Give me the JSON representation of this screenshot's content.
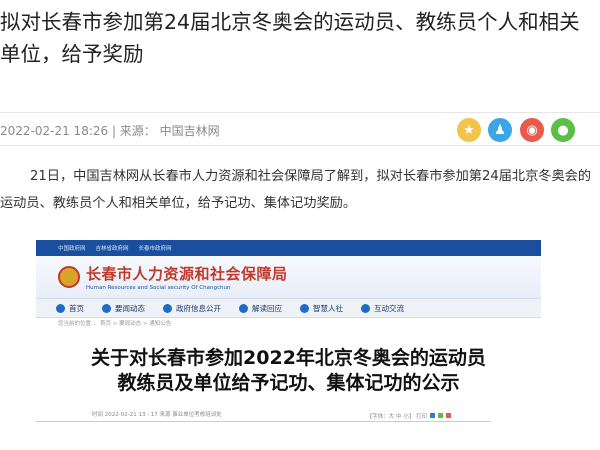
{
  "article": {
    "title": "拟对长春市参加第24届北京冬奥会的运动员、教练员个人和相关单位，给予奖励",
    "meta": "2022-02-21 18:26 | 来源： 中国吉林网",
    "paragraph": "21日，中国吉林网从长春市人力资源和社会保障局了解到，拟对长春市参加第24届北京冬奥会的运动员、教练员个人和相关单位，给予记功、集体记功奖励。"
  },
  "share": {
    "icons": [
      "star-icon",
      "qq-icon",
      "weibo-icon",
      "wechat-icon"
    ],
    "colors": [
      "#f4c44a",
      "#3aa6e6",
      "#e85b4b",
      "#5bbf45"
    ]
  },
  "screenshot": {
    "top_links": [
      "中国政府网",
      "吉林省政府网",
      "长春市政府网"
    ],
    "bureau_name": "长春市人力资源和社会保障局",
    "bureau_en": "Human Resources and Social security Of Changchun",
    "nav": [
      "首页",
      "要闻动态",
      "政府信息公开",
      "解读回应",
      "智慧人社",
      "互动交流"
    ],
    "breadcrumb": "您当前的位置 ： 首页 > 要闻动态 > 通知公告",
    "notice_title_line1": "关于对长春市参加2022年北京冬奥会的运动员",
    "notice_title_line2": "教练员及单位给予记功、集体记功的公示",
    "notice_meta": "时间   2022-02-21 13 : 17   来源   事业单位考核培训处",
    "notice_tools": "【字体：大 中 小】   打印"
  }
}
